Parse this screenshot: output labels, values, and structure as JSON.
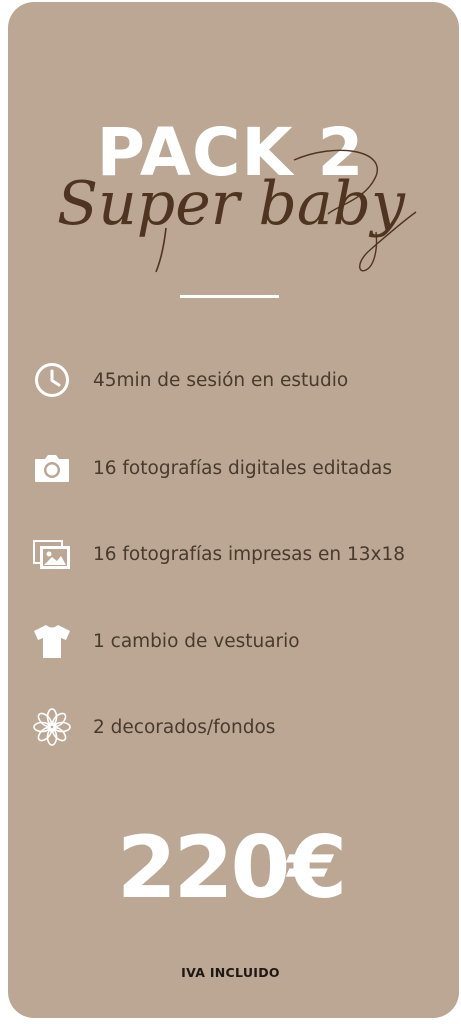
{
  "pack": {
    "title": "PACK 2",
    "subtitle": "Super baby"
  },
  "features": [
    {
      "icon": "clock-icon",
      "text": "45min de sesión en estudio"
    },
    {
      "icon": "camera-icon",
      "text": "16 fotografías digitales editadas"
    },
    {
      "icon": "photos-icon",
      "text": "16 fotografías impresas en 13x18"
    },
    {
      "icon": "tshirt-icon",
      "text": "1 cambio de vestuario"
    },
    {
      "icon": "flower-icon",
      "text": "2 decorados/fondos"
    }
  ],
  "price": "220€",
  "tax_note": "IVA INCLUIDO",
  "colors": {
    "card_background": "#bba794",
    "text_dark": "#4a3a2d",
    "script_brown": "#4e3421",
    "white": "#ffffff"
  }
}
